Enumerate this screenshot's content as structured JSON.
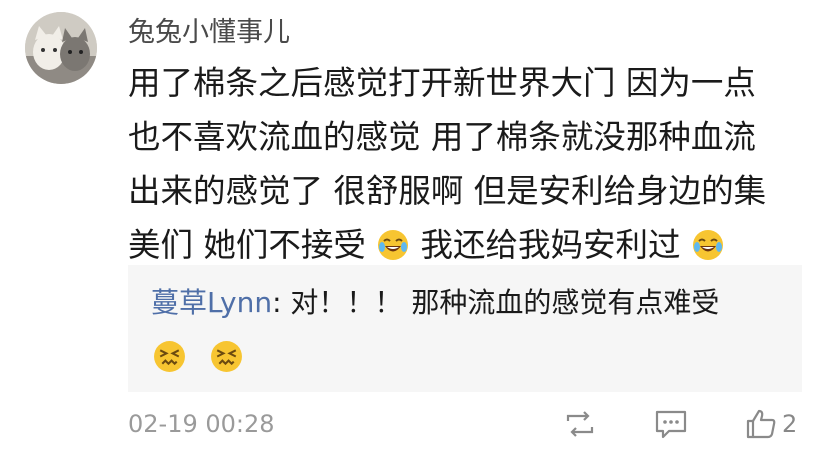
{
  "comment": {
    "username": "兔兔小懂事儿",
    "lines": [
      {
        "text": "用了棉条之后感觉打开新世界大门 因为一点"
      },
      {
        "text": "也不喜欢流血的感觉 用了棉条就没那种血流"
      },
      {
        "text": "出来的感觉了 很舒服啊 但是安利给身边的集"
      }
    ],
    "last_line": {
      "part1": "美们 她们不接受",
      "part2": "我还给我妈安利过"
    },
    "emoji_laugh": "laughing-crying-emoji"
  },
  "reply": {
    "author": "蔓草Lynn",
    "separator": ":",
    "text": " 对！！！ 那种流血的感觉有点难受",
    "emoji": "persevering-face-emoji"
  },
  "footer": {
    "timestamp": "02-19 00:28",
    "like_count": "2",
    "icons": [
      "repost-icon",
      "comment-icon",
      "thumbs-up-icon"
    ]
  }
}
